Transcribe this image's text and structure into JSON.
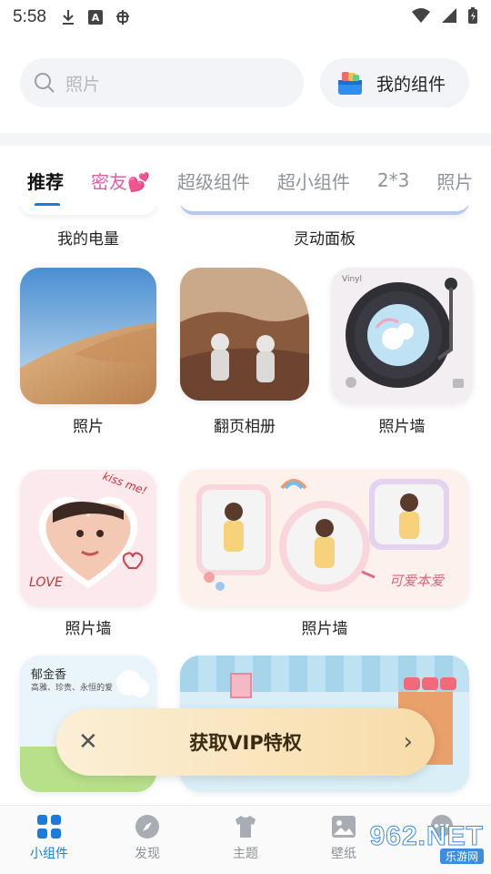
{
  "status_bar": {
    "time": "5:58"
  },
  "search": {
    "placeholder": "照片"
  },
  "my_widgets": {
    "label": "我的组件"
  },
  "tabs": [
    {
      "label": "推荐",
      "active": true
    },
    {
      "label": "密友💕",
      "active": false
    },
    {
      "label": "超级组件",
      "active": false
    },
    {
      "label": "超小组件",
      "active": false
    },
    {
      "label": "2*3",
      "active": false
    },
    {
      "label": "照片",
      "active": false
    }
  ],
  "grid": {
    "row0_labels": [
      "我的电量",
      "灵动面板"
    ],
    "row1_labels": [
      "照片",
      "翻页相册",
      "照片墙"
    ],
    "row2_labels": [
      "照片墙",
      "照片墙"
    ],
    "card_texts": {
      "vinyl_brand": "Vinyl",
      "kiss_text": "kiss me!",
      "love_text": "LOVE",
      "cute_text": "可爱本爱",
      "flower_title": "郁金香",
      "flower_sub": "高雅、珍贵、永恒的爱"
    }
  },
  "vip_banner": {
    "label": "获取VIP特权"
  },
  "bottom_nav": [
    {
      "label": "小组件",
      "icon": "grid-icon",
      "active": true
    },
    {
      "label": "发现",
      "icon": "compass-icon",
      "active": false
    },
    {
      "label": "主题",
      "icon": "shirt-icon",
      "active": false
    },
    {
      "label": "壁纸",
      "icon": "image-icon",
      "active": false
    },
    {
      "label": "",
      "icon": "chat-icon",
      "active": false
    }
  ],
  "watermark": {
    "top": "962.NET",
    "bottom": "乐游网"
  },
  "colors": {
    "accent": "#1a7bdc",
    "pink": "#e05fa2"
  }
}
